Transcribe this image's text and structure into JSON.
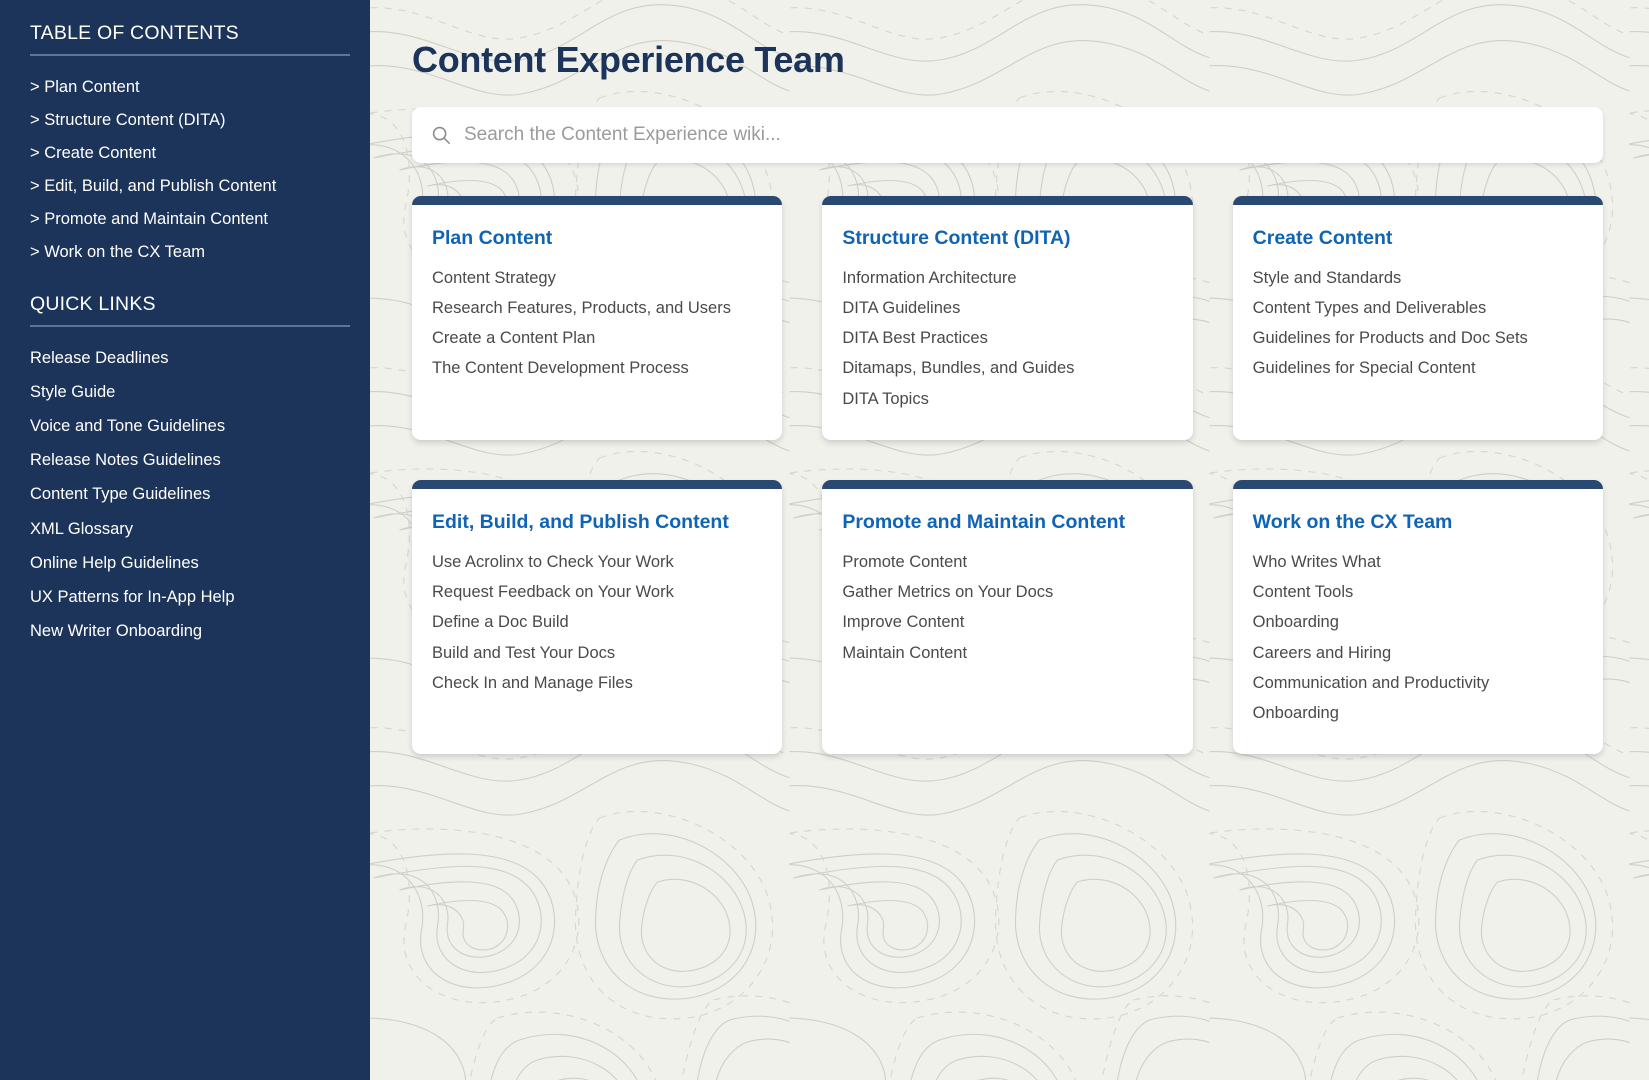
{
  "sidebar": {
    "toc": {
      "title": "TABLE OF CONTENTS",
      "items": [
        {
          "label": "> Plan Content"
        },
        {
          "label": "> Structure Content (DITA)"
        },
        {
          "label": "> Create Content"
        },
        {
          "label": "> Edit, Build, and Publish Content"
        },
        {
          "label": "> Promote and Maintain Content"
        },
        {
          "label": "> Work on the CX Team"
        }
      ]
    },
    "quick_links": {
      "title": "QUICK LINKS",
      "items": [
        {
          "label": "Release Deadlines"
        },
        {
          "label": "Style Guide"
        },
        {
          "label": "Voice and Tone Guidelines"
        },
        {
          "label": "Release Notes Guidelines"
        },
        {
          "label": "Content Type Guidelines"
        },
        {
          "label": "XML Glossary"
        },
        {
          "label": "Online Help Guidelines"
        },
        {
          "label": "UX Patterns for In-App Help"
        },
        {
          "label": "New Writer Onboarding"
        }
      ]
    }
  },
  "header": {
    "title": "Content Experience Team"
  },
  "search": {
    "placeholder": "Search the Content Experience wiki...",
    "value": "",
    "icon": "search-icon"
  },
  "cards": [
    {
      "title": "Plan Content",
      "links": [
        "Content Strategy",
        "Research Features, Products, and Users",
        "Create a Content Plan",
        "The Content Development Process"
      ]
    },
    {
      "title": "Structure Content (DITA)",
      "links": [
        "Information Architecture",
        "DITA Guidelines",
        "DITA Best Practices",
        "Ditamaps, Bundles, and Guides",
        "DITA Topics"
      ]
    },
    {
      "title": "Create Content",
      "links": [
        "Style and Standards",
        "Content Types and Deliverables",
        "Guidelines for Products and Doc Sets",
        "Guidelines for Special Content"
      ]
    },
    {
      "title": "Edit, Build, and Publish Content",
      "links": [
        "Use Acrolinx to Check Your Work",
        "Request Feedback on Your Work",
        "Define a Doc Build",
        "Build and Test Your Docs",
        "Check In and Manage Files"
      ]
    },
    {
      "title": "Promote and Maintain Content",
      "links": [
        "Promote Content",
        "Gather Metrics on Your Docs",
        "Improve Content",
        "Maintain Content"
      ]
    },
    {
      "title": "Work on the CX Team",
      "links": [
        "Who Writes What",
        "Content Tools",
        "Onboarding",
        "Careers and Hiring",
        "Communication and Productivity",
        "Onboarding"
      ]
    }
  ],
  "colors": {
    "sidebar_navy": "#1c3459",
    "card_bar_navy": "#2a4972",
    "heading_blue": "#1064b6",
    "title_navy": "#1c3459",
    "page_bg": "#f1f1ec",
    "link_gray": "#4a4a4a",
    "placeholder_gray": "#9b9b9b"
  }
}
